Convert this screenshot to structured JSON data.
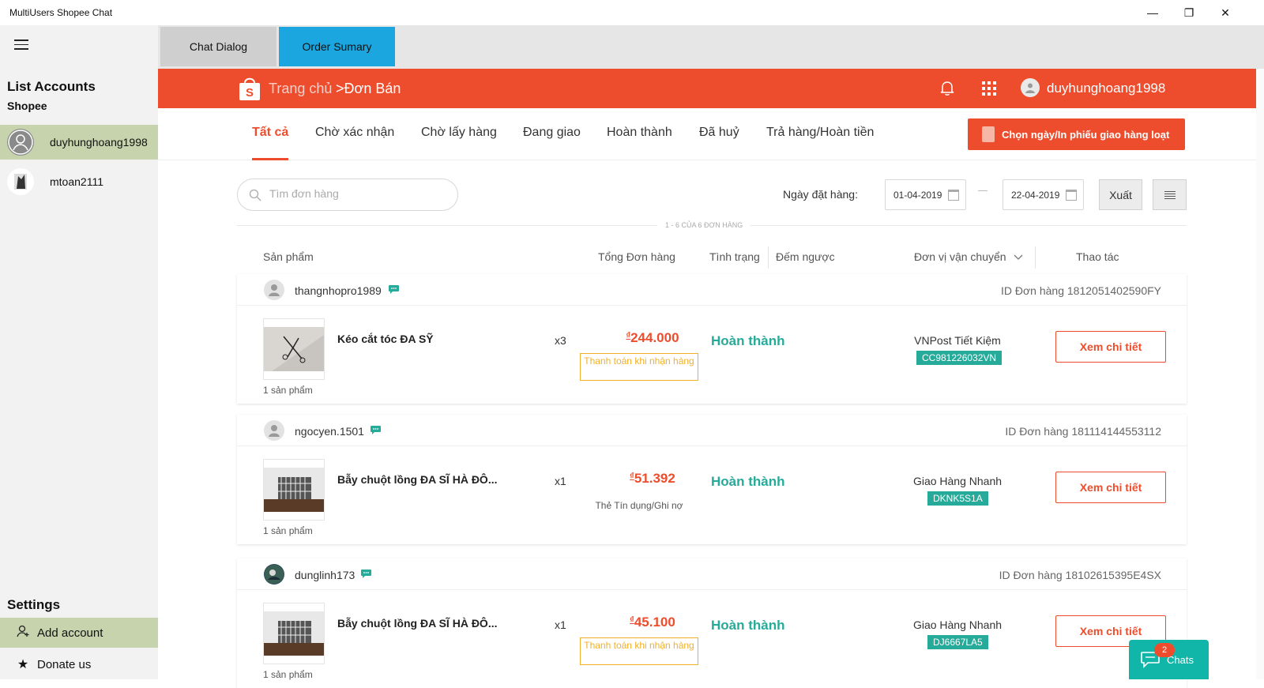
{
  "window": {
    "title": "MultiUsers Shopee Chat",
    "minimize": "—",
    "maximize": "❐",
    "close": "✕"
  },
  "sidebar": {
    "heading": "List Accounts",
    "subheading": "Shopee",
    "accounts": [
      {
        "name": "duyhunghoang1998",
        "active": true
      },
      {
        "name": "mtoan2111",
        "active": false
      }
    ],
    "settings_heading": "Settings",
    "add_account": "Add account",
    "donate": "Donate us"
  },
  "tabs": [
    {
      "label": "Chat Dialog"
    },
    {
      "label": "Order Sumary"
    }
  ],
  "header": {
    "crumb_home": "Trang chủ",
    "crumb_current": ">Đơn Bán",
    "username": "duyhunghoang1998",
    "brand_color": "#ee4d2d"
  },
  "status_tabs": [
    "Tất cả",
    "Chờ xác nhận",
    "Chờ lấy hàng",
    "Đang giao",
    "Hoàn thành",
    "Đã huỷ",
    "Trả hàng/Hoàn tiền"
  ],
  "bulk_button": "Chọn ngày/In phiếu giao hàng loạt",
  "filters": {
    "search_placeholder": "Tìm đơn hàng",
    "date_label": "Ngày đặt hàng:",
    "date_from": "01-04-2019",
    "date_to": "22-04-2019",
    "export_label": "Xuất"
  },
  "count_text": "1 - 6 CỦA 6 ĐƠN HÀNG",
  "columns": [
    "Sản phẩm",
    "Tổng Đơn hàng",
    "Tình trạng",
    "Đếm ngược",
    "Đơn vị vận chuyển",
    "Thao tác"
  ],
  "orders": [
    {
      "buyer": "thangnhopro1989",
      "order_id": "ID Đơn hàng 1812051402590FY",
      "product": "Kéo cắt tóc ĐA SỸ",
      "qty": "x3",
      "price_currency": "₫",
      "price": "244.000",
      "payment": "Thanh toán khi nhận hàng",
      "status": "Hoàn thành",
      "carrier": "VNPost Tiết Kiệm",
      "tracking": "CC981226032VN",
      "product_count": "1 sản phẩm",
      "action": "Xem chi tiết"
    },
    {
      "buyer": "ngocyen.1501",
      "order_id": "ID Đơn hàng 181114144553112",
      "product": "Bẫy chuột lồng ĐA SĨ HÀ ĐÔ...",
      "qty": "x1",
      "price_currency": "₫",
      "price": "51.392",
      "payment": "Thẻ Tín dụng/Ghi nợ",
      "status": "Hoàn thành",
      "carrier": "Giao Hàng Nhanh",
      "tracking": "DKNK5S1A",
      "product_count": "1 sản phẩm",
      "action": "Xem chi tiết"
    },
    {
      "buyer": "dunglinh173",
      "order_id": "ID Đơn hàng 18102615395E4SX",
      "product": "Bẫy chuột lồng ĐA SĨ HÀ ĐÔ...",
      "qty": "x1",
      "price_currency": "₫",
      "price": "45.100",
      "payment": "Thanh toán khi nhận hàng",
      "status": "Hoàn thành",
      "carrier": "Giao Hàng Nhanh",
      "tracking": "DJ6667LA5",
      "product_count": "1 sản phẩm",
      "action": "Xem chi tiết"
    }
  ],
  "chats": {
    "label": "Chats",
    "badge": "2"
  },
  "colors": {
    "accent": "#ee4d2d",
    "success": "#26aa99",
    "tab_active": "#1ba6e0",
    "sidebar_active": "#c6d3ad",
    "pay_cod": "#f2b02a"
  }
}
